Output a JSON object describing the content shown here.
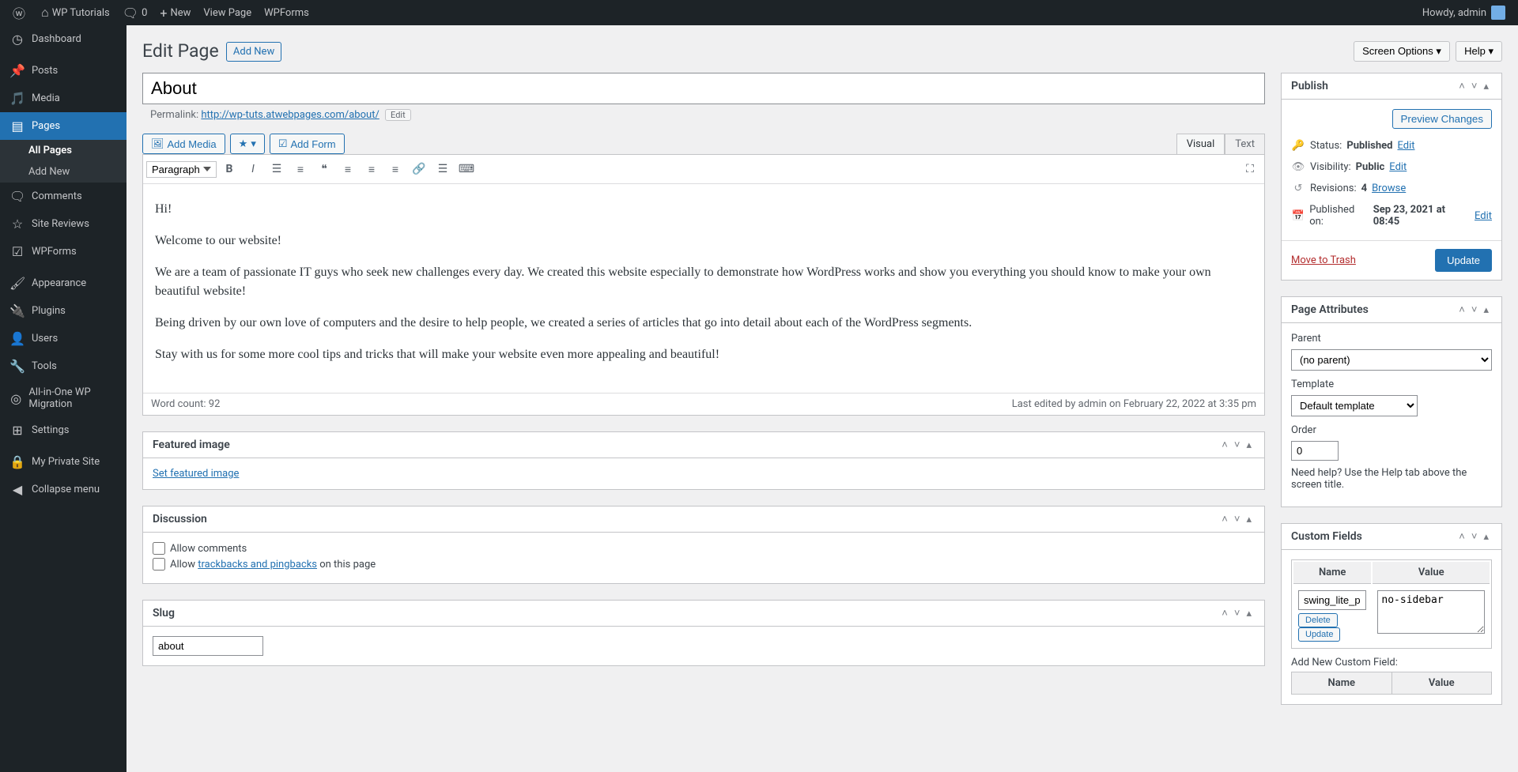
{
  "adminbar": {
    "site_name": "WP Tutorials",
    "comments_count": "0",
    "new_label": "New",
    "view_page": "View Page",
    "wpforms": "WPForms",
    "howdy": "Howdy, admin"
  },
  "menu": {
    "dashboard": "Dashboard",
    "posts": "Posts",
    "media": "Media",
    "pages": "Pages",
    "all_pages": "All Pages",
    "add_new": "Add New",
    "comments": "Comments",
    "site_reviews": "Site Reviews",
    "wpforms": "WPForms",
    "appearance": "Appearance",
    "plugins": "Plugins",
    "users": "Users",
    "tools": "Tools",
    "aio": "All-in-One WP Migration",
    "settings": "Settings",
    "private_site": "My Private Site",
    "collapse": "Collapse menu"
  },
  "top": {
    "screen_options": "Screen Options ▾",
    "help": "Help ▾"
  },
  "heading": {
    "title": "Edit Page",
    "add_new": "Add New"
  },
  "page_title": "About",
  "permalink": {
    "label": "Permalink:",
    "url": "http://wp-tuts.atwebpages.com/about/",
    "edit": "Edit"
  },
  "editor_buttons": {
    "add_media": "Add Media",
    "add_form": "Add Form",
    "visual": "Visual",
    "text": "Text",
    "paragraph": "Paragraph"
  },
  "content": {
    "p1": "Hi!",
    "p2": "Welcome to our website!",
    "p3": "We are a team of passionate IT guys who seek new challenges every day. We created this website especially to demonstrate how WordPress works and show you everything you should know to make your own beautiful website!",
    "p4": "Being driven by our own love of computers and the desire to help people, we created a series of articles that go into detail about each of the WordPress segments.",
    "p5": "Stay with us for some more cool tips and tricks that will make your website even more appealing and beautiful!"
  },
  "status_bar": {
    "word_count": "Word count: 92",
    "last_edit": "Last edited by admin on February 22, 2022 at 3:35 pm"
  },
  "featured": {
    "title": "Featured image",
    "link": "Set featured image"
  },
  "discussion": {
    "title": "Discussion",
    "allow_comments": "Allow comments",
    "allow_trackbacks_pre": "Allow ",
    "trackbacks_link": "trackbacks and pingbacks",
    "allow_trackbacks_post": " on this page"
  },
  "slug": {
    "title": "Slug",
    "value": "about"
  },
  "publish": {
    "title": "Publish",
    "preview": "Preview Changes",
    "status_label": "Status:",
    "status_value": "Published",
    "visibility_label": "Visibility:",
    "visibility_value": "Public",
    "revisions_label": "Revisions:",
    "revisions_value": "4",
    "browse": "Browse",
    "published_label": "Published on:",
    "published_value": "Sep 23, 2021 at 08:45",
    "edit": "Edit",
    "trash": "Move to Trash",
    "update": "Update"
  },
  "attrs": {
    "title": "Page Attributes",
    "parent": "Parent",
    "parent_val": "(no parent)",
    "template": "Template",
    "template_val": "Default template",
    "order": "Order",
    "order_val": "0",
    "help": "Need help? Use the Help tab above the screen title."
  },
  "custom_fields": {
    "title": "Custom Fields",
    "name_header": "Name",
    "value_header": "Value",
    "existing_name": "swing_lite_p",
    "existing_value": "no-sidebar",
    "delete": "Delete",
    "update": "Update",
    "add_new_label": "Add New Custom Field:"
  }
}
